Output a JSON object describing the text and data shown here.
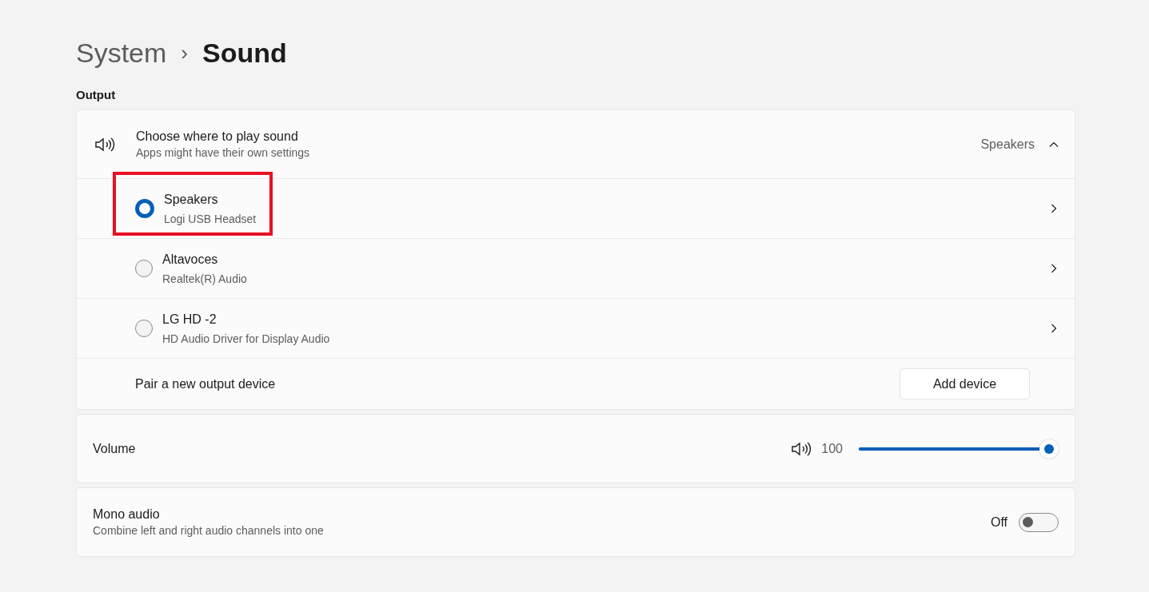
{
  "breadcrumb": {
    "parent": "System",
    "separator": "›",
    "current": "Sound"
  },
  "section_title": "Output",
  "output_card": {
    "title": "Choose where to play sound",
    "subtitle": "Apps might have their own settings",
    "current_value": "Speakers",
    "expanded": true,
    "devices": [
      {
        "name": "Speakers",
        "driver": "Logi USB Headset",
        "selected": true,
        "highlighted": true
      },
      {
        "name": "Altavoces",
        "driver": "Realtek(R) Audio",
        "selected": false,
        "highlighted": false
      },
      {
        "name": "LG HD -2",
        "driver": "HD Audio Driver for Display Audio",
        "selected": false,
        "highlighted": false
      }
    ],
    "pair": {
      "label": "Pair a new output device",
      "button": "Add device"
    }
  },
  "volume": {
    "label": "Volume",
    "reading": "100",
    "level": 1.0
  },
  "mono_audio": {
    "title": "Mono audio",
    "subtitle": "Combine left and right audio channels into one",
    "state_label": "Off",
    "on": false
  }
}
